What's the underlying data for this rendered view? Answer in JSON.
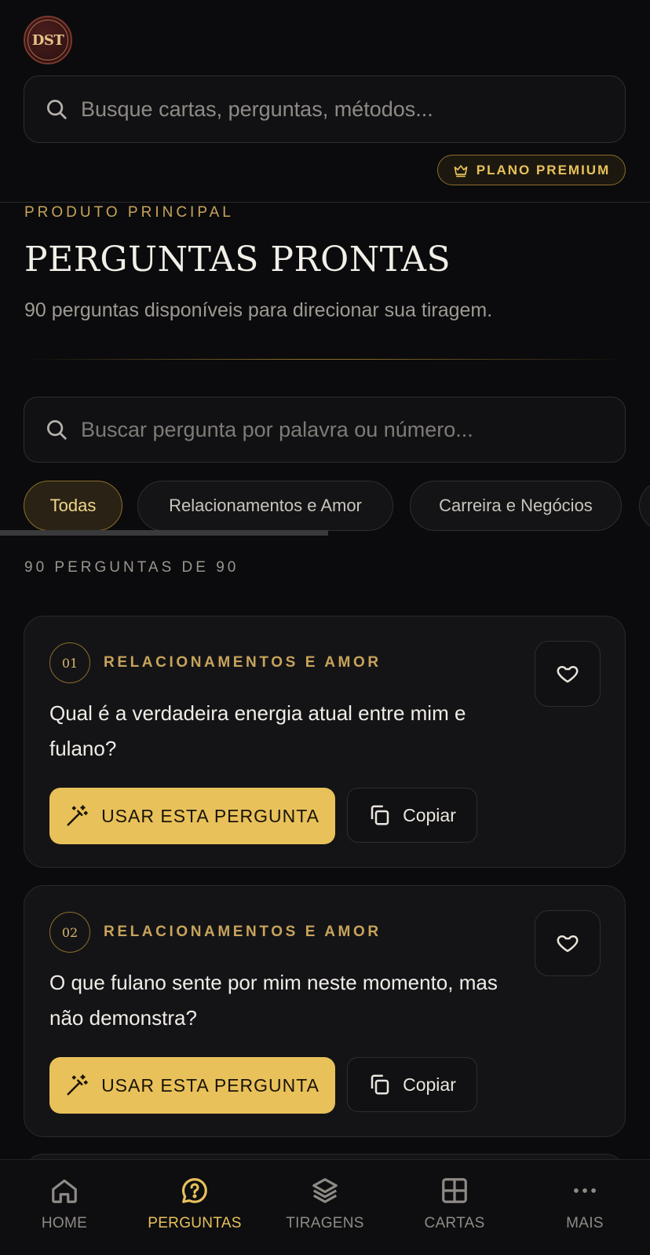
{
  "header": {
    "logo_text": "DST",
    "search_placeholder": "Busque cartas, perguntas, métodos...",
    "premium_label": "PLANO PREMIUM"
  },
  "page": {
    "eyebrow": "PRODUTO PRINCIPAL",
    "title": "PERGUNTAS PRONTAS",
    "subtitle": "90 perguntas disponíveis para direcionar sua tiragem."
  },
  "filter": {
    "search_placeholder": "Buscar pergunta por palavra ou número...",
    "chips": [
      "Todas",
      "Relacionamentos e Amor",
      "Carreira e Negócios"
    ],
    "active_chip": "Todas",
    "count_label": "90 PERGUNTAS DE 90"
  },
  "questions": [
    {
      "number": "01",
      "category": "RELACIONAMENTOS E AMOR",
      "text": "Qual é a verdadeira energia atual entre mim e fulano?",
      "use_label": "USAR ESTA PERGUNTA",
      "copy_label": "Copiar",
      "favorite_icon": "heart-icon"
    },
    {
      "number": "02",
      "category": "RELACIONAMENTOS E AMOR",
      "text": "O que fulano sente por mim neste momento, mas não demonstra?",
      "use_label": "USAR ESTA PERGUNTA",
      "copy_label": "Copiar",
      "favorite_icon": "heart-icon"
    }
  ],
  "nav": {
    "items": [
      {
        "label": "HOME",
        "icon": "home-icon"
      },
      {
        "label": "PERGUNTAS",
        "icon": "question-bubble-icon"
      },
      {
        "label": "TIRAGENS",
        "icon": "layers-icon"
      },
      {
        "label": "CARTAS",
        "icon": "grid-icon"
      },
      {
        "label": "MAIS",
        "icon": "more-dots-icon"
      }
    ],
    "active": "PERGUNTAS"
  },
  "colors": {
    "background": "#0b0b0d",
    "accent_gold": "#e8c15a",
    "card": "#141417"
  }
}
